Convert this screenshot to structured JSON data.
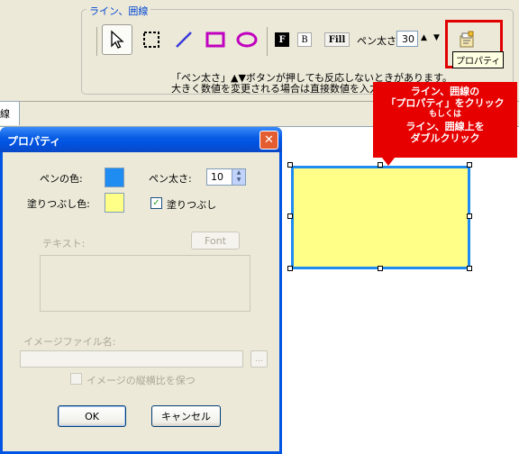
{
  "toolbar": {
    "group_label": "ライン、囲線",
    "tools": [
      {
        "name": "select-tool",
        "icon": "pointer-arrow"
      },
      {
        "name": "marquee-tool",
        "icon": "dashed-rect"
      },
      {
        "name": "line-tool",
        "icon": "diagonal-line"
      },
      {
        "name": "rect-tool",
        "icon": "rectangle"
      },
      {
        "name": "ellipse-tool",
        "icon": "ellipse"
      }
    ],
    "format": {
      "font_label": "F",
      "bold_label": "B",
      "fill_label": "Fill"
    },
    "pen_width_label": "ペン太さ",
    "pen_width_value": "30",
    "spin_up": "▲",
    "spin_down": "▼",
    "properties_tooltip": "プロパティ",
    "hint_line1": "「ペン太さ」▲▼ボタンが押しても反応しないときがあります。",
    "hint_line2": "大きく数値を変更される場合は直接数値を入力"
  },
  "tabs": {
    "line_tab": "線"
  },
  "callout": {
    "line1": "ライン、囲線の",
    "line2": "「プロパティ」をクリック",
    "line3": "もしくは",
    "line4": "ライン、囲線上を",
    "line5": "ダブルクリック"
  },
  "dialog": {
    "title": "プロパティ",
    "close": "✕",
    "pen_color_label": "ペンの色:",
    "fill_color_label": "塗りつぶし色:",
    "pen_width_label": "ペン太さ:",
    "pen_width_value": "10",
    "fill_checkbox_label": "塗りつぶし",
    "fill_checked": true,
    "text_label": "テキスト:",
    "font_button": "Font",
    "image_file_label": "イメージファイル名:",
    "browse_button": "...",
    "keep_ratio_label": "イメージの縦横比を保つ",
    "ok_button": "OK",
    "cancel_button": "キャンセル"
  },
  "colors": {
    "pen_color": "#1e8cf0",
    "fill_color": "#ffff88",
    "callout_red": "#e60000",
    "accent": "#0054e3"
  }
}
